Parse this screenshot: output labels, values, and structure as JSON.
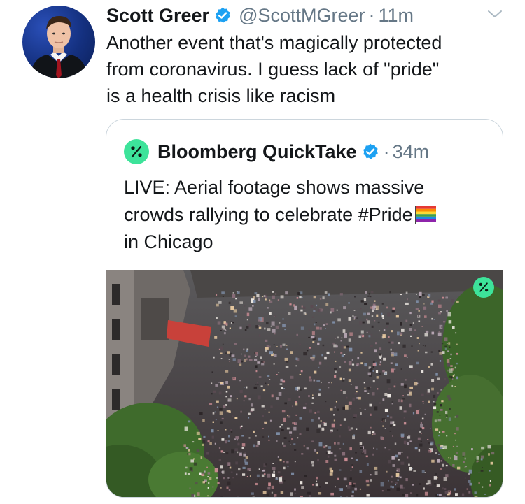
{
  "tweet": {
    "author_name": "Scott Greer",
    "handle": "@ScottMGreer",
    "separator": "·",
    "time": "11m",
    "text_lines": [
      "Another event that's magically protected",
      "from coronavirus. I guess lack of \"pride\"",
      "is a health crisis like racism"
    ],
    "verified_icon": "verified-badge-icon",
    "menu_icon": "chevron-down-icon"
  },
  "quoted_tweet": {
    "author_name": "Bloomberg QuickTake",
    "separator": "·",
    "time": "34m",
    "text_lines": [
      "LIVE: Aerial footage shows massive",
      "crowds rallying to celebrate #Pride",
      "in Chicago"
    ],
    "trailing_emoji": "rainbow-flag-emoji",
    "logo_icon": "quicktake-logo-icon",
    "media": {
      "description_icon": "aerial-crowd-video-thumbnail",
      "badge_icon": "quicktake-logo-icon"
    }
  },
  "colors": {
    "text": "#14171a",
    "secondary": "#657786",
    "verified": "#1da1f2",
    "quicktake_green": "#3de39a",
    "border": "#ccd6dd"
  }
}
